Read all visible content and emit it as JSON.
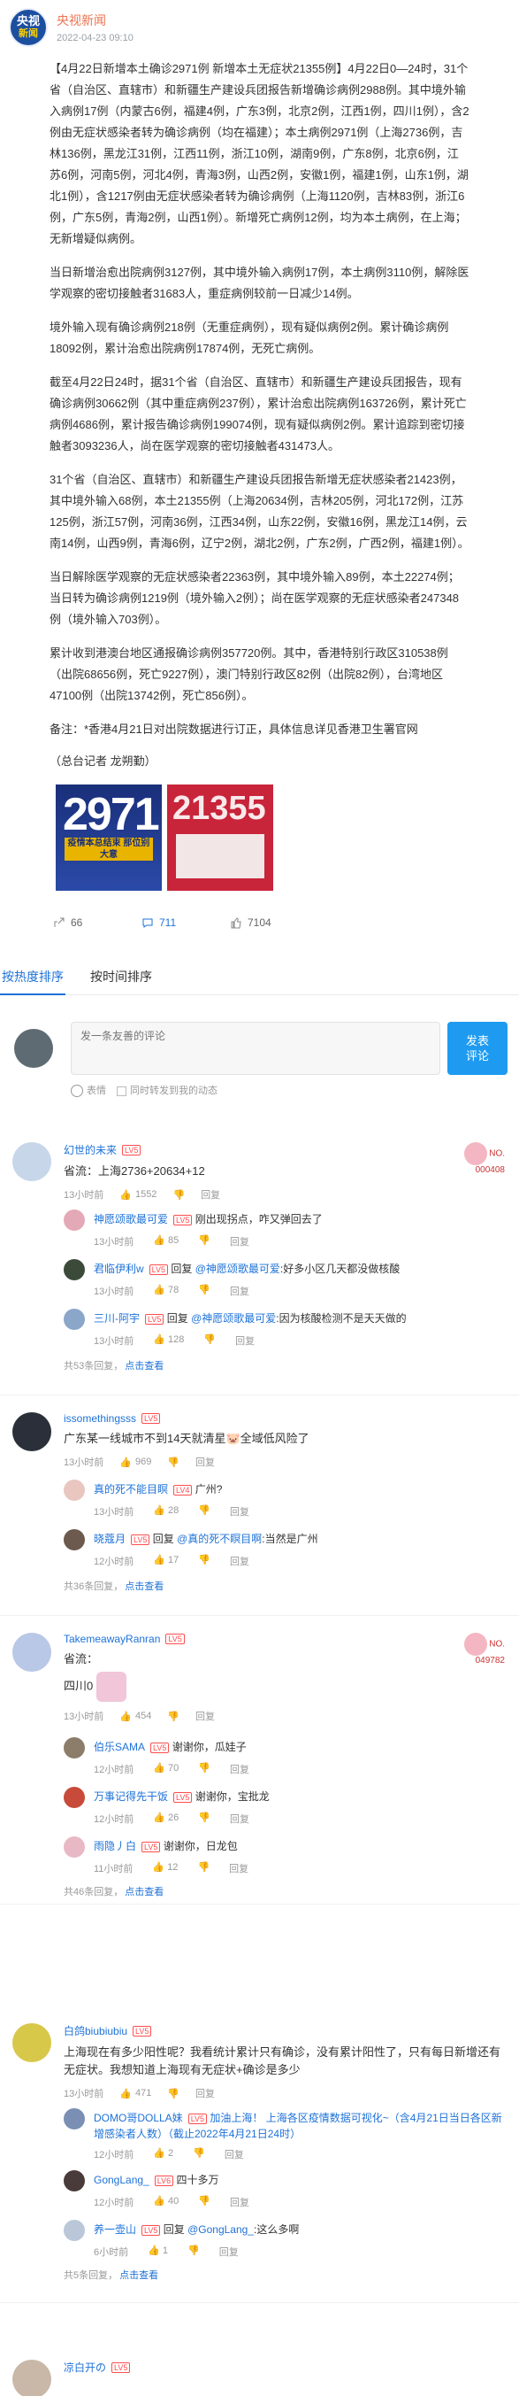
{
  "author": {
    "name": "央视新闻",
    "avatar_line1": "央视",
    "avatar_line2": "新闻",
    "time": "2022-04-23 09:10"
  },
  "post": {
    "paragraphs": [
      "【4月22日新增本土确诊2971例 新增本土无症状21355例】4月22日0—24时，31个省（自治区、直辖市）和新疆生产建设兵团报告新增确诊病例2988例。其中境外输入病例17例（内蒙古6例，福建4例，广东3例，北京2例，江西1例，四川1例），含2例由无症状感染者转为确诊病例（均在福建）；本土病例2971例（上海2736例，吉林136例，黑龙江31例，江西11例，浙江10例，湖南9例，广东8例，北京6例，江苏6例，河南5例，河北4例，青海3例，山西2例，安徽1例，福建1例，山东1例，湖北1例），含1217例由无症状感染者转为确诊病例（上海1120例，吉林83例，浙江6例，广东5例，青海2例，山西1例）。新增死亡病例12例，均为本土病例，在上海；无新增疑似病例。",
      "当日新增治愈出院病例3127例，其中境外输入病例17例，本土病例3110例，解除医学观察的密切接触者31683人，重症病例较前一日减少14例。",
      "境外输入现有确诊病例218例（无重症病例），现有疑似病例2例。累计确诊病例18092例，累计治愈出院病例17874例，无死亡病例。",
      "截至4月22日24时，据31个省（自治区、直辖市）和新疆生产建设兵团报告，现有确诊病例30662例（其中重症病例237例），累计治愈出院病例163726例，累计死亡病例4686例，累计报告确诊病例199074例，现有疑似病例2例。累计追踪到密切接触者3093236人，尚在医学观察的密切接触者431473人。",
      "31个省（自治区、直辖市）和新疆生产建设兵团报告新增无症状感染者21423例，其中境外输入68例，本土21355例（上海20634例，吉林205例，河北172例，江苏125例，浙江57例，河南36例，江西34例，山东22例，安徽16例，黑龙江14例，云南14例，山西9例，青海6例，辽宁2例，湖北2例，广东2例，广西2例，福建1例）。",
      "当日解除医学观察的无症状感染者22363例，其中境外输入89例，本土22274例；当日转为确诊病例1219例（境外输入2例）；尚在医学观察的无症状感染者247348例（境外输入703例）。",
      "累计收到港澳台地区通报确诊病例357720例。其中，香港特别行政区310538例（出院68656例，死亡9227例），澳门特别行政区82例（出院82例），台湾地区47100例（出院13742例，死亡856例）。",
      "备注：*香港4月21日对出院数据进行订正，具体信息详见香港卫生署官网"
    ],
    "editor": "（总台记者 龙朔勤）"
  },
  "images": {
    "img1_number": "2971",
    "img1_caption": "疫情本总结束 那位别大意",
    "img2_number": "21355"
  },
  "stats": {
    "shares": "66",
    "comments": "711",
    "likes": "7104"
  },
  "tabs": [
    "按热度排序",
    "按时间排序"
  ],
  "compose": {
    "placeholder": "发一条友善的评论",
    "emoji_label": "表情",
    "repost_label": "同时转发到我的动态",
    "send_label": "发表\n评论"
  },
  "comments": [
    {
      "name": "幻世的未来",
      "level": "LV5",
      "no_label": "NO.",
      "no_value": "000408",
      "text": "省流：上海2736+20634+12",
      "time": "13小时前",
      "likes": "1552",
      "reply": "回复",
      "replies": [
        {
          "name": "神愿颂歌最可爱",
          "level": "LV5",
          "text": "刚出现拐点，咋又弹回去了",
          "time": "13小时前",
          "likes": "85",
          "reply": "回复"
        },
        {
          "name": "君临伊利w",
          "level": "LV5",
          "prefix": "回复",
          "to": "@神愿颂歌最可爱",
          "text": ":好多小区几天都没做核酸",
          "time": "13小时前",
          "likes": "78",
          "reply": "回复"
        },
        {
          "name": "三川-阿宇",
          "level": "LV5",
          "prefix": "回复",
          "to": "@神愿颂歌最可爱",
          "text": ":因为核酸检测不是天天做的",
          "time": "13小时前",
          "likes": "128",
          "reply": "回复"
        }
      ],
      "more_text": "共53条回复，",
      "more_link": "点击查看"
    },
    {
      "name": "issomethingsss",
      "level": "LV5",
      "text": "广东某一线城市不到14天就清星🐷全域低风险了",
      "time": "13小时前",
      "likes": "969",
      "reply": "回复",
      "replies": [
        {
          "name": "真的死不能目瞑",
          "level": "LV4",
          "text": "广州?",
          "time": "13小时前",
          "likes": "28",
          "reply": "回复"
        },
        {
          "name": "晓蔻月",
          "level": "LV5",
          "prefix": "回复",
          "to": "@真的死不瞑目啊",
          "text": ":当然是广州",
          "time": "12小时前",
          "likes": "17",
          "reply": "回复"
        }
      ],
      "more_text": "共36条回复，",
      "more_link": "点击查看"
    },
    {
      "name": "TakemeawayRanran",
      "level": "LV5",
      "no_label": "NO.",
      "no_value": "049782",
      "text": "省流：",
      "text2": "四川0",
      "time": "13小时前",
      "likes": "454",
      "reply": "回复",
      "replies": [
        {
          "name": "伯乐SAMA",
          "level": "LV5",
          "text": "谢谢你，瓜娃子",
          "time": "12小时前",
          "likes": "70",
          "reply": "回复"
        },
        {
          "name": "万事记得先干饭",
          "level": "LV5",
          "text": "谢谢你，宝批龙",
          "time": "12小时前",
          "likes": "26",
          "reply": "回复"
        },
        {
          "name": "雨隐丿白",
          "level": "LV5",
          "text": "谢谢你，日龙包",
          "time": "11小时前",
          "likes": "12",
          "reply": "回复"
        }
      ],
      "more_text": "共46条回复，",
      "more_link": "点击查看"
    },
    {
      "name": "白鸽biubiubiu",
      "level": "LV5",
      "text": "上海现在有多少阳性呢？我看统计累计只有确诊，没有累计阳性了，只有每日新增还有无症状。我想知道上海现有无症状+确诊是多少",
      "time": "13小时前",
      "likes": "471",
      "reply": "回复",
      "replies": [
        {
          "name": "DOMO哥DOLLA妹",
          "level": "LV5",
          "text": "加油上海！ 上海各区疫情数据可视化~（含4月21日当日各区新增感染者人数）（截止2022年4月21日24时）",
          "time": "12小时前",
          "likes": "2",
          "reply": "回复"
        },
        {
          "name": "GongLang_",
          "level": "LV6",
          "text": "四十多万",
          "time": "12小时前",
          "likes": "40",
          "reply": "回复"
        },
        {
          "name": "养一壶山",
          "level": "LV5",
          "prefix": "回复",
          "to": "@GongLang_",
          "text": ":这么多啊",
          "time": "6小时前",
          "likes": "1",
          "reply": "回复"
        }
      ],
      "more_text": "共5条回复，",
      "more_link": "点击查看"
    },
    {
      "name": "凉白开の",
      "level": "LV5"
    }
  ]
}
